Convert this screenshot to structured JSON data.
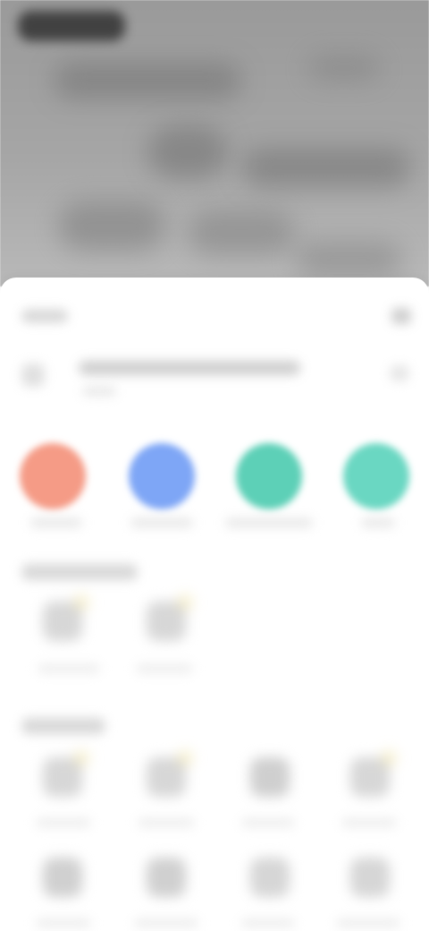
{
  "theme": {
    "hero_bg": "#a4a4a4",
    "sheet_bg": "#ffffff",
    "orange": "#f59b86",
    "blue": "#7ea6f6",
    "teal": "#5dd0b7",
    "mint": "#6ad7c2"
  },
  "icons": {
    "back": "chevron-left-icon",
    "settings": "settings-icon"
  },
  "primary_actions": [
    {
      "name": "action-orange",
      "color": "orange"
    },
    {
      "name": "action-blue",
      "color": "blue"
    },
    {
      "name": "action-teal",
      "color": "teal"
    },
    {
      "name": "action-mint",
      "color": "mint"
    }
  ],
  "sections": [
    {
      "name": "section-1"
    },
    {
      "name": "section-2"
    }
  ]
}
